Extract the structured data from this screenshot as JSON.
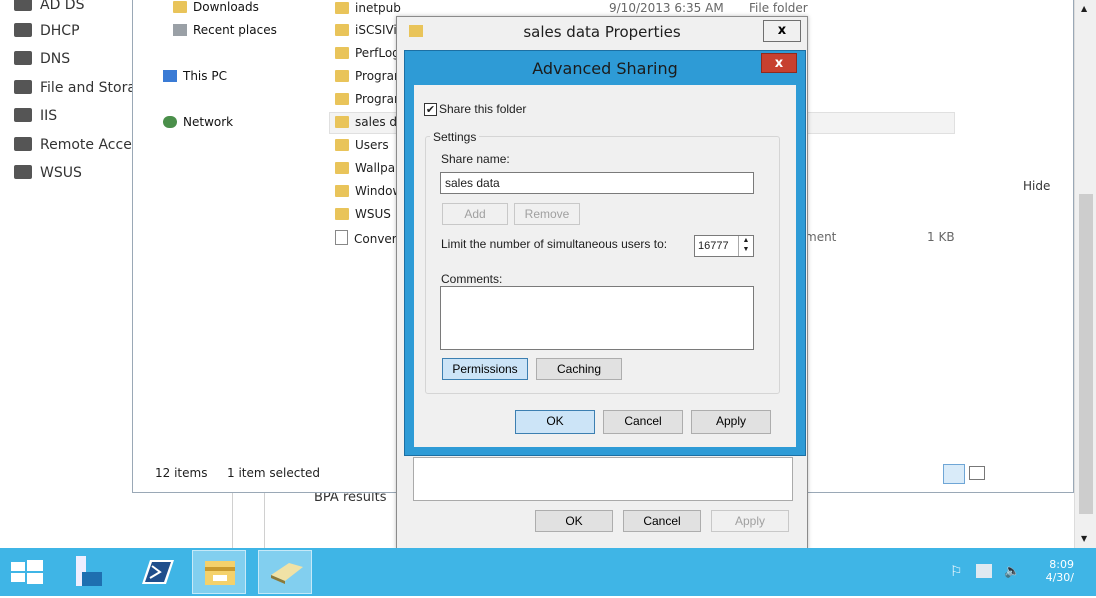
{
  "server_nav": {
    "items": [
      {
        "label": "AD DS",
        "icon": "ad-ds-icon"
      },
      {
        "label": "DHCP",
        "icon": "dhcp-icon"
      },
      {
        "label": "DNS",
        "icon": "dns-icon"
      },
      {
        "label": "File and Stora",
        "icon": "file-storage-icon"
      },
      {
        "label": "IIS",
        "icon": "iis-icon"
      },
      {
        "label": "Remote Acce",
        "icon": "remote-access-icon"
      },
      {
        "label": "WSUS",
        "icon": "wsus-icon"
      }
    ]
  },
  "explorer": {
    "nav": {
      "downloads": "Downloads",
      "recent": "Recent places",
      "this_pc": "This PC",
      "network": "Network"
    },
    "files": [
      "inetpub",
      "iSCSIVi",
      "PerfLog",
      "Prograr",
      "Prograr",
      "sales da",
      "Users",
      "Wallpa",
      "Window",
      "WSUS",
      "Conver"
    ],
    "first_row_date": "9/10/2013 6:35 AM",
    "first_row_type": "File folder",
    "conver_type_fragment": "ment",
    "conver_size": "1 KB",
    "status_items": "12 items",
    "status_selected": "1 item selected"
  },
  "background": {
    "hide_label": "Hide",
    "bpa_label": "BPA results"
  },
  "properties_dialog": {
    "title": "sales data Properties",
    "ok": "OK",
    "cancel": "Cancel",
    "apply": "Apply"
  },
  "advanced_sharing": {
    "title": "Advanced Sharing",
    "close_glyph": "x",
    "share_checkbox_label": "Share this folder",
    "share_checked": true,
    "settings_label": "Settings",
    "share_name_label": "Share name:",
    "share_name_value": "sales data",
    "add": "Add",
    "remove": "Remove",
    "limit_label": "Limit the number of simultaneous users to:",
    "limit_value": "16777",
    "comments_label": "Comments:",
    "comments_value": "",
    "permissions": "Permissions",
    "caching": "Caching",
    "ok": "OK",
    "cancel": "Cancel",
    "apply": "Apply"
  },
  "taskbar": {
    "clock_time": "8:09",
    "clock_date": "4/30/"
  },
  "colors": {
    "taskbar": "#3fb5e6",
    "dialog_frame": "#2e9bd6",
    "close_red": "#c7402f"
  }
}
